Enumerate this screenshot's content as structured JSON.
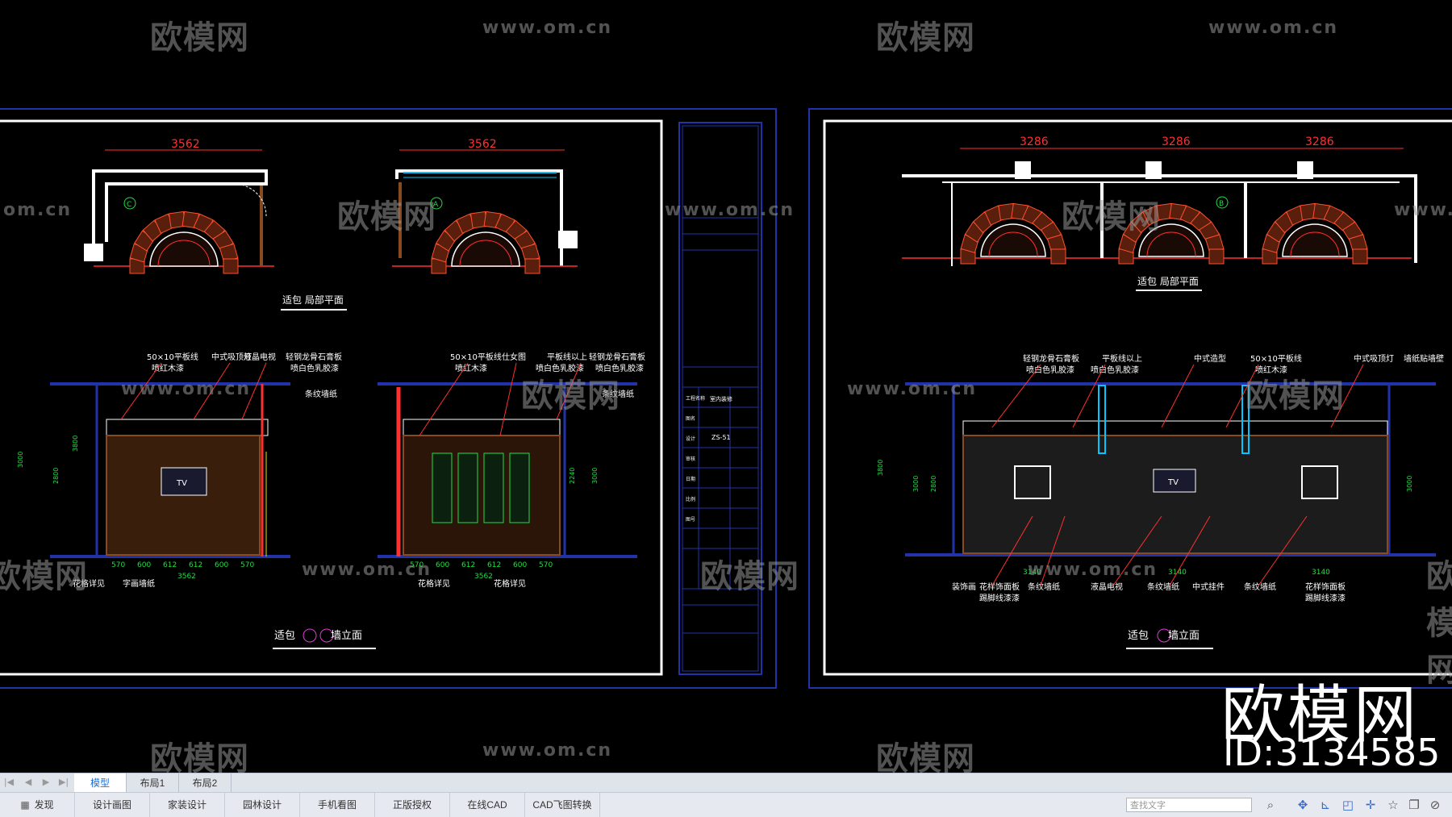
{
  "watermark": {
    "brand": "欧模网",
    "url": "www.om.cn",
    "url_partial": "om.cn",
    "id_text": "ID:3134585"
  },
  "drawing_left": {
    "dim_top_1": "3562",
    "dim_top_2": "3562",
    "plan_title": "适包 局部平面",
    "elev_title_prefix": "适包",
    "elev_title_suffix": "墙立面",
    "mark_a": "A",
    "mark_c": "C",
    "tv": "TV",
    "notes_left": [
      "50×10平板线",
      "喷红木漆",
      "中式吸顶灯",
      "液晶电视",
      "轻钢龙骨石膏板",
      "喷白色乳胶漆",
      "条纹墙纸",
      "花格详见",
      "字画墙纸"
    ],
    "notes_right": [
      "50×10平板线",
      "喷红木漆",
      "仕女图",
      "平板线以上",
      "喷白色乳胶漆",
      "轻钢龙骨石膏板",
      "喷白色乳胶漆",
      "条纹墙纸",
      "花格详见",
      "花格详见"
    ],
    "dims_bottom_1": [
      "570",
      "600",
      "612",
      "612",
      "600",
      "570"
    ],
    "dims_bottom_2": [
      "570",
      "600",
      "612",
      "612",
      "600",
      "570"
    ],
    "sum_1": "3562",
    "sum_2": "3562",
    "heights": [
      "3000",
      "2800",
      "3800",
      "2240",
      "3000"
    ]
  },
  "title_block": {
    "code": "ZS-51",
    "project": "室内装修",
    "rows": [
      "工程名称",
      "图名",
      "设计",
      "审核",
      "日期",
      "比例",
      "图号"
    ]
  },
  "drawing_right": {
    "dims_top": [
      "3286",
      "3286",
      "3286"
    ],
    "plan_title": "适包 局部平面",
    "elev_title_prefix": "适包",
    "elev_title_suffix": "墙立面",
    "mark_b": "B",
    "tv": "TV",
    "notes_top": [
      "轻钢龙骨石膏板",
      "喷白色乳胶漆",
      "平板线以上",
      "喷白色乳胶漆",
      "中式造型",
      "50×10平板线",
      "喷红木漆",
      "中式吸顶灯",
      "墙纸贴墙壁"
    ],
    "notes_bottom": [
      "装饰画",
      "花样饰面板",
      "踢脚线漆漆",
      "条纹墙纸",
      "液晶电视",
      "条纹墙纸",
      "中式挂件",
      "条纹墙纸",
      "花样饰面板",
      "踢脚线漆漆"
    ],
    "dims_bottom": [
      "3140",
      "3140",
      "3140"
    ],
    "heights": [
      "3800",
      "3000",
      "2800",
      "3000"
    ]
  },
  "tabs": {
    "items": [
      {
        "label": "模型",
        "active": true
      },
      {
        "label": "布局1",
        "active": false
      },
      {
        "label": "布局2",
        "active": false
      }
    ]
  },
  "toolbar": {
    "discover": "发现",
    "items": [
      "设计画图",
      "家装设计",
      "园林设计",
      "手机看图",
      "正版授权",
      "在线CAD",
      "CAD飞图转换"
    ],
    "search_placeholder": "查找文字"
  },
  "colors": {
    "frame_blue": "#2233aa",
    "cad_white": "#ffffff",
    "cad_red": "#ff3030",
    "cad_green": "#22dd44",
    "cad_yellow": "#e6e600",
    "cad_cyan": "#00c8ff",
    "cad_magenta": "#e23ad8",
    "wood": "#8a4a20"
  }
}
